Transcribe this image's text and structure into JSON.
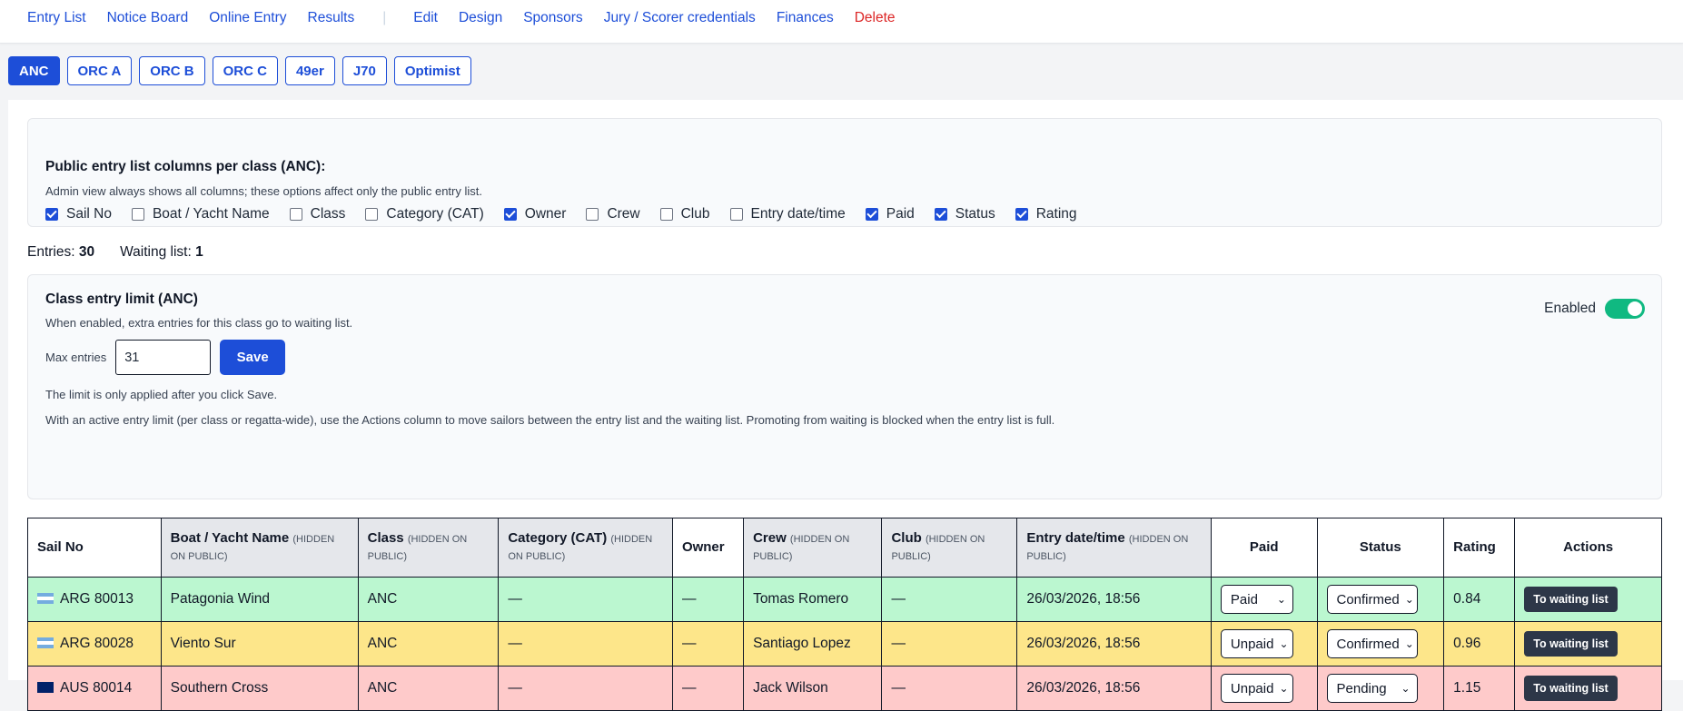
{
  "nav": {
    "primary": [
      "Entry List",
      "Notice Board",
      "Online Entry",
      "Results"
    ],
    "separator": "|",
    "secondary": [
      "Edit",
      "Design",
      "Sponsors",
      "Jury / Scorer credentials",
      "Finances"
    ],
    "delete": "Delete"
  },
  "class_tabs": [
    "ANC",
    "ORC A",
    "ORC B",
    "ORC C",
    "49er",
    "J70",
    "Optimist"
  ],
  "active_tab": "ANC",
  "columns_card": {
    "title": "Public entry list columns per class (ANC):",
    "subtitle": "Admin view always shows all columns; these options affect only the public entry list.",
    "options": [
      {
        "label": "Sail No",
        "checked": true
      },
      {
        "label": "Boat / Yacht Name",
        "checked": false
      },
      {
        "label": "Class",
        "checked": false
      },
      {
        "label": "Category (CAT)",
        "checked": false
      },
      {
        "label": "Owner",
        "checked": true
      },
      {
        "label": "Crew",
        "checked": false
      },
      {
        "label": "Club",
        "checked": false
      },
      {
        "label": "Entry date/time",
        "checked": false
      },
      {
        "label": "Paid",
        "checked": true
      },
      {
        "label": "Status",
        "checked": true
      },
      {
        "label": "Rating",
        "checked": true
      }
    ]
  },
  "counts": {
    "entries_label": "Entries:",
    "entries": "30",
    "waiting_label": "Waiting list:",
    "waiting": "1"
  },
  "limit_card": {
    "title": "Class entry limit (ANC)",
    "subtitle": "When enabled, extra entries for this class go to waiting list.",
    "enabled_label": "Enabled",
    "enabled": true,
    "max_label": "Max entries",
    "max_value": "31",
    "save_label": "Save",
    "note1": "The limit is only applied after you click Save.",
    "note2": "With an active entry limit (per class or regatta-wide), use the Actions column to move sailors between the entry list and the waiting list. Promoting from waiting is blocked when the entry list is full."
  },
  "table": {
    "hidden_note": "(HIDDEN ON PUBLIC)",
    "headers": {
      "sail": "Sail No",
      "boat": "Boat / Yacht Name",
      "class": "Class",
      "category": "Category (CAT)",
      "owner": "Owner",
      "crew": "Crew",
      "club": "Club",
      "entry": "Entry date/time",
      "paid": "Paid",
      "status": "Status",
      "rating": "Rating",
      "actions": "Actions"
    },
    "rows": [
      {
        "color": "green",
        "flag": "ar",
        "sail": "ARG 80013",
        "boat": "Patagonia Wind",
        "class": "ANC",
        "category": "—",
        "owner": "—",
        "crew": "Tomas Romero",
        "club": "—",
        "entry": "26/03/2026, 18:56",
        "paid": "Paid",
        "status": "Confirmed",
        "rating": "0.84",
        "action": "To waiting list"
      },
      {
        "color": "yellow",
        "flag": "ar",
        "sail": "ARG 80028",
        "boat": "Viento Sur",
        "class": "ANC",
        "category": "—",
        "owner": "—",
        "crew": "Santiago Lopez",
        "club": "—",
        "entry": "26/03/2026, 18:56",
        "paid": "Unpaid",
        "status": "Confirmed",
        "rating": "0.96",
        "action": "To waiting list"
      },
      {
        "color": "red",
        "flag": "au",
        "sail": "AUS 80014",
        "boat": "Southern Cross",
        "class": "ANC",
        "category": "—",
        "owner": "—",
        "crew": "Jack Wilson",
        "club": "—",
        "entry": "26/03/2026, 18:56",
        "paid": "Unpaid",
        "status": "Pending",
        "rating": "1.15",
        "action": "To waiting list"
      }
    ]
  },
  "colors": {
    "accent": "#1d4ed8",
    "danger": "#dc2626",
    "toggle_on": "#10b981",
    "row_green": "#bbf7d0",
    "row_yellow": "#fde68a",
    "row_red": "#fecaca"
  }
}
